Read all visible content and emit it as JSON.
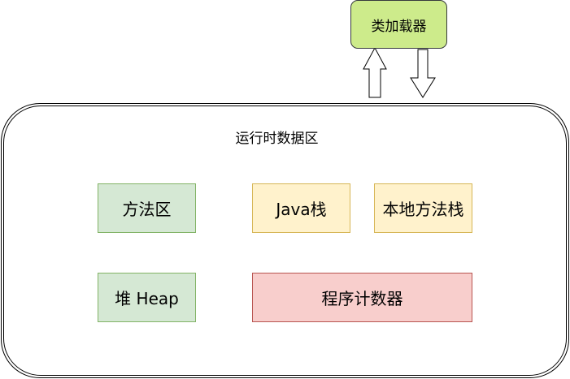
{
  "class_loader": {
    "label": "类加载器"
  },
  "runtime_data_area": {
    "title": "运行时数据区",
    "components": {
      "method_area": "方法区",
      "java_stack": "Java栈",
      "native_method_stack": "本地方法栈",
      "heap": "堆 Heap",
      "program_counter": "程序计数器"
    }
  },
  "colors": {
    "class_loader_fill": "#cdeb8b",
    "green_fill": "#d5e8d4",
    "green_border": "#82b366",
    "yellow_fill": "#fff2cc",
    "yellow_border": "#d6b656",
    "red_fill": "#f8cecc",
    "red_border": "#b85450"
  }
}
